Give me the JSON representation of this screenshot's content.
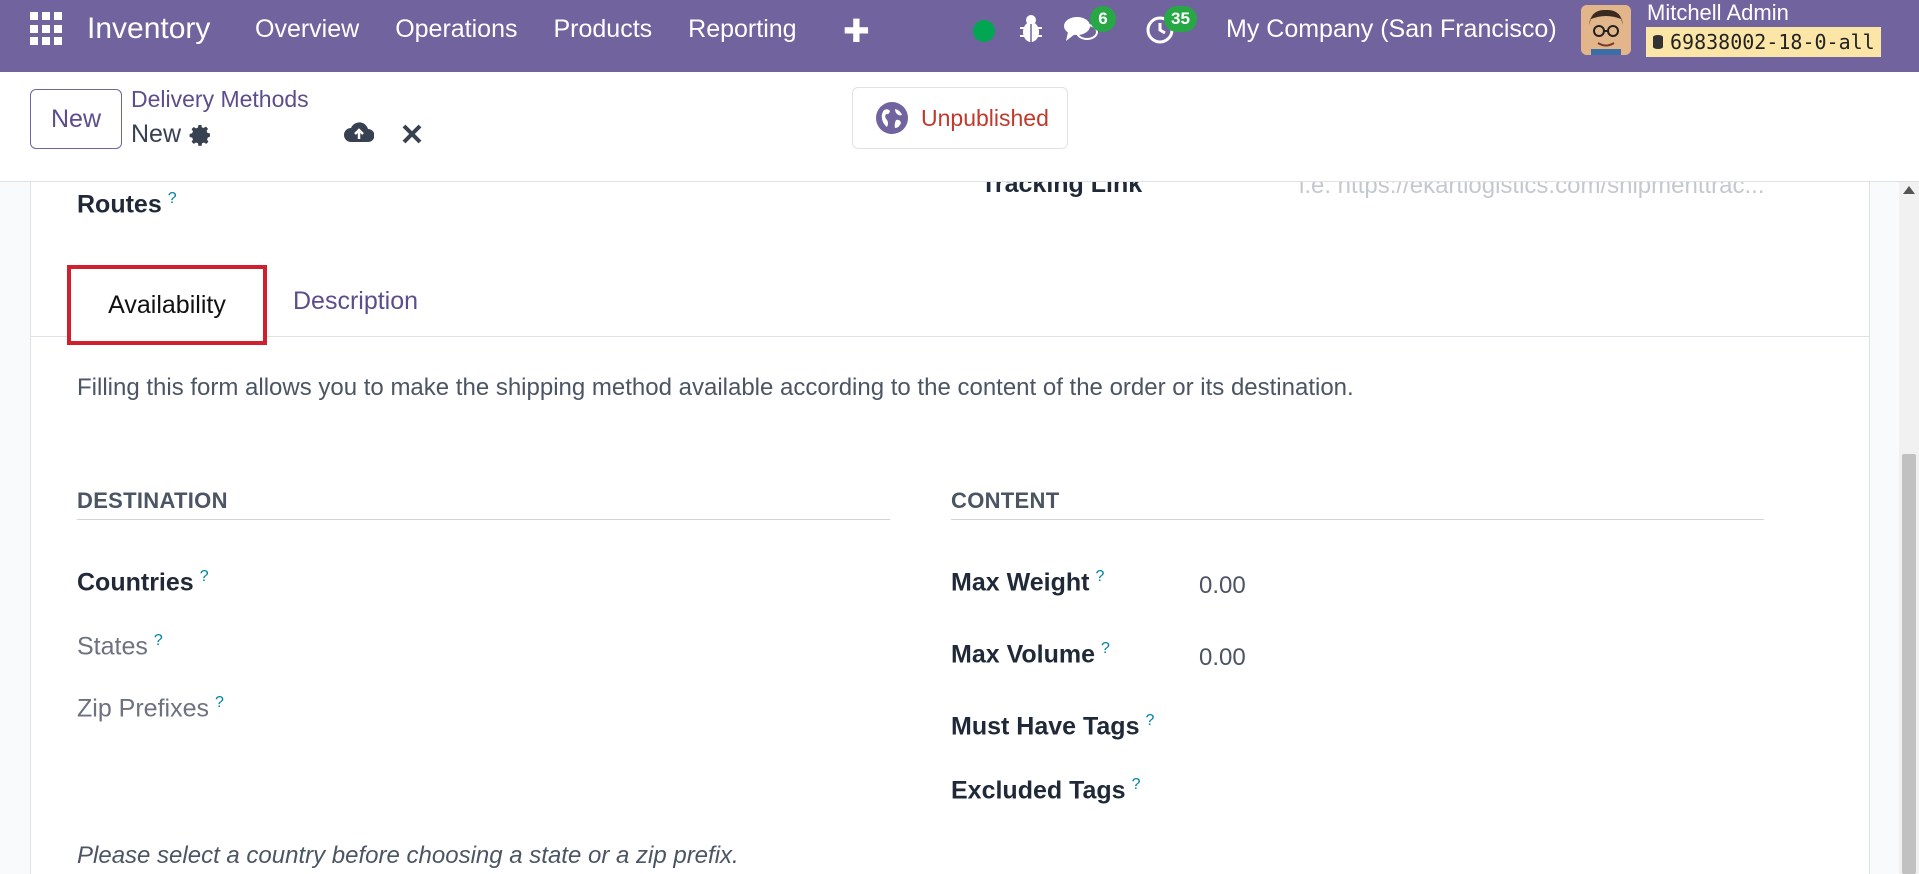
{
  "navbar": {
    "brand": "Inventory",
    "menu": [
      "Overview",
      "Operations",
      "Products",
      "Reporting"
    ],
    "messages_count": "6",
    "activities_count": "35",
    "company": "My Company (San Francisco)",
    "user_name": "Mitchell Admin",
    "database": "69838002-18-0-all",
    "accent_color": "#71639e",
    "status_color": "#00a651"
  },
  "control": {
    "new_label": "New",
    "breadcrumb": "Delivery Methods",
    "record_name": "New",
    "publish_label": "Unpublished"
  },
  "form": {
    "tracking_label": "Tracking Link",
    "tracking_placeholder": "i.e. https://ekartlogistics.com/shipmenttrac...",
    "routes_label": "Routes",
    "tabs": [
      "Availability",
      "Description"
    ],
    "help_text": "Filling this form allows you to make the shipping method available according to the content of the order or its destination.",
    "destination": {
      "title": "DESTINATION",
      "countries": "Countries",
      "states": "States",
      "zip_prefixes": "Zip Prefixes"
    },
    "content": {
      "title": "CONTENT",
      "max_weight_label": "Max Weight",
      "max_weight_value": "0.00",
      "max_volume_label": "Max Volume",
      "max_volume_value": "0.00",
      "must_have_tags": "Must Have Tags",
      "excluded_tags": "Excluded Tags"
    },
    "help_mark": "?",
    "foot_note": "Please select a country before choosing a state or a zip prefix."
  }
}
